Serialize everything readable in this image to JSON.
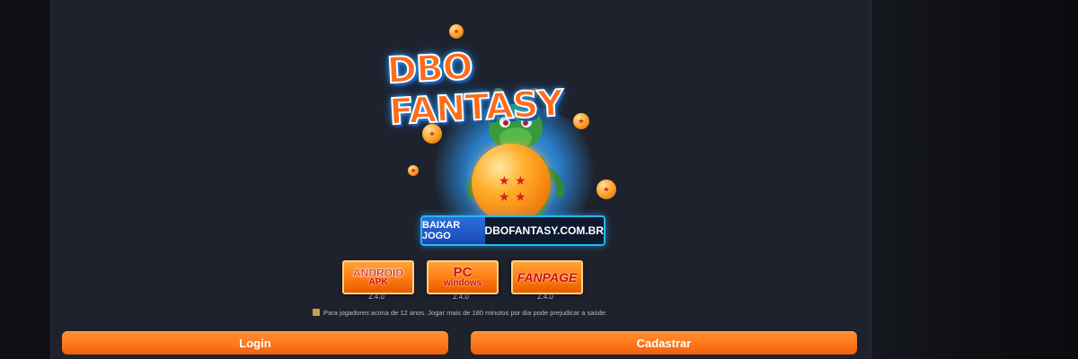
{
  "logo": {
    "title": "DBO FANTASY",
    "banner_left": "BAIXAR JOGO",
    "banner_right": "DBOFANTASY.COM.BR",
    "accent_color": "#ff6b1a",
    "glow_color": "#27b6ff"
  },
  "downloads": [
    {
      "line1": "ANDROID",
      "line2": "APK",
      "version": "2.4.0",
      "icon": "android-apk-button"
    },
    {
      "line1": "PC",
      "line2": "windows",
      "version": "2.4.0",
      "icon": "pc-windows-button"
    },
    {
      "line1": "FANPAGE",
      "line2": "",
      "version": "2.4.0",
      "icon": "fanpage-button"
    }
  ],
  "notice": "Para jogadores acima de 12 anos. Jogar mais de 180 minutos por dia pode prejudicar a saúde.",
  "actions": {
    "login": "Login",
    "register": "Cadastrar"
  },
  "colors": {
    "panel_bg": "#1e222d",
    "button_orange": "#ff7a1a"
  }
}
